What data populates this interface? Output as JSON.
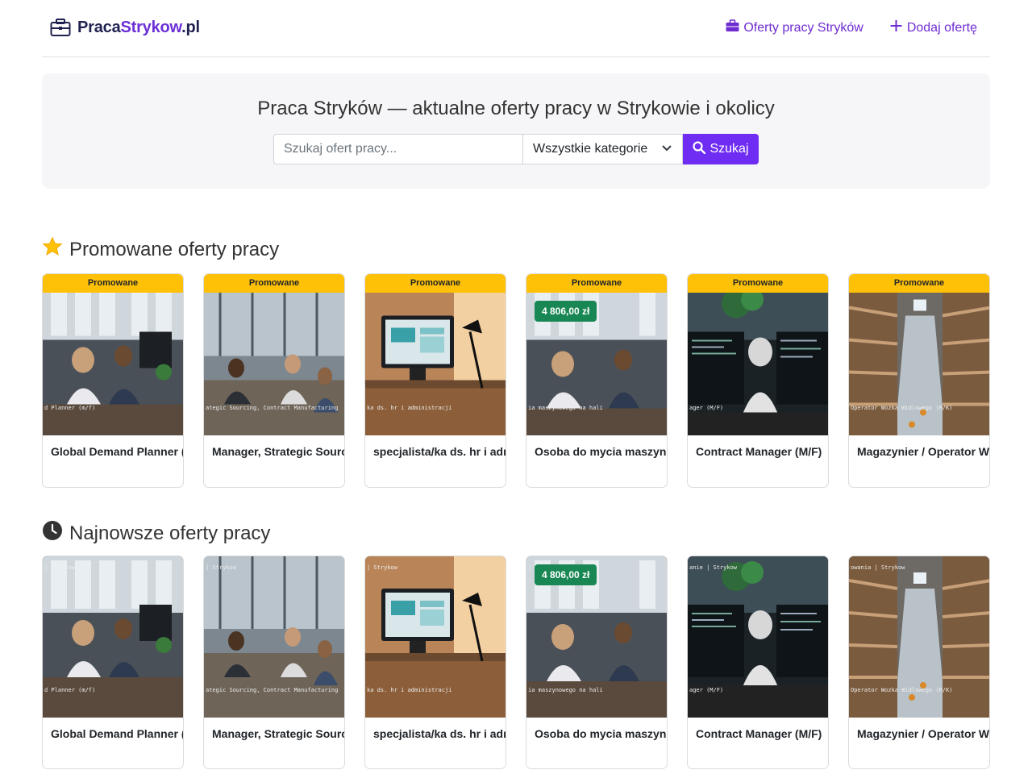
{
  "brand": {
    "part1": "Praca",
    "part2": "Strykow",
    "part3": ".pl"
  },
  "nav": [
    {
      "label": "Oferty pracy Stryków",
      "icon": "briefcase-icon"
    },
    {
      "label": "Dodaj ofertę",
      "icon": "plus-icon"
    }
  ],
  "hero": {
    "title": "Praca Stryków — aktualne oferty pracy w Strykowie i okolicy",
    "search_placeholder": "Szukaj ofert pracy...",
    "category_selected": "Wszystkie kategorie",
    "search_button": "Szukaj"
  },
  "promoted": {
    "title": "Promowane oferty pracy",
    "badge": "Promowane",
    "items": [
      {
        "title": "Global Demand Planner (m/f)",
        "caption": "d Planner (m/f)",
        "salary": ""
      },
      {
        "title": "Manager, Strategic Sourcing, Contract Manufacturing",
        "caption": "ategic Sourcing, Contract Manufacturing",
        "salary": ""
      },
      {
        "title": "specjalista/ka ds. hr i administracji",
        "caption": "ka ds. hr i administracji",
        "salary": ""
      },
      {
        "title": "Osoba do mycia maszynowego na hali",
        "caption": "ia maszynowego na hali",
        "salary": "4 806,00 zł"
      },
      {
        "title": "Contract Manager (M/F)",
        "caption": "ager (M/F)",
        "salary": ""
      },
      {
        "title": "Magazynier / Operator Wózka Widłowego (M/K)",
        "caption": "Operator Wozka Widlowego (M/K)",
        "salary": ""
      }
    ]
  },
  "latest": {
    "title": "Najnowsze oferty pracy",
    "items": [
      {
        "title": "Global Demand Planner (m/f)",
        "caption": "d Planner (m/f)",
        "top": "| Strykow",
        "salary": ""
      },
      {
        "title": "Manager, Strategic Sourcing, Contract Manufacturing",
        "caption": "ategic Sourcing, Contract Manufacturing",
        "top": "| Strykow",
        "salary": ""
      },
      {
        "title": "specjalista/ka ds. hr i administracji",
        "caption": "ka ds. hr i administracji",
        "top": "| Strykow",
        "salary": ""
      },
      {
        "title": "Osoba do mycia maszynowego na hali",
        "caption": "ia maszynowego na hali",
        "top": "| Strykow",
        "salary": "4 806,00 zł"
      },
      {
        "title": "Contract Manager (M/F)",
        "caption": "ager (M/F)",
        "top": "anie | Strykow",
        "salary": ""
      },
      {
        "title": "Magazynier / Operator Wózka Widłowego (M/K)",
        "caption": "Operator Wozka Widlowego (M/K)",
        "top": "owania | Strykow",
        "salary": ""
      }
    ]
  },
  "colors": {
    "accent": "#6f2cf3",
    "promo": "#ffc107",
    "salary": "#198754"
  }
}
